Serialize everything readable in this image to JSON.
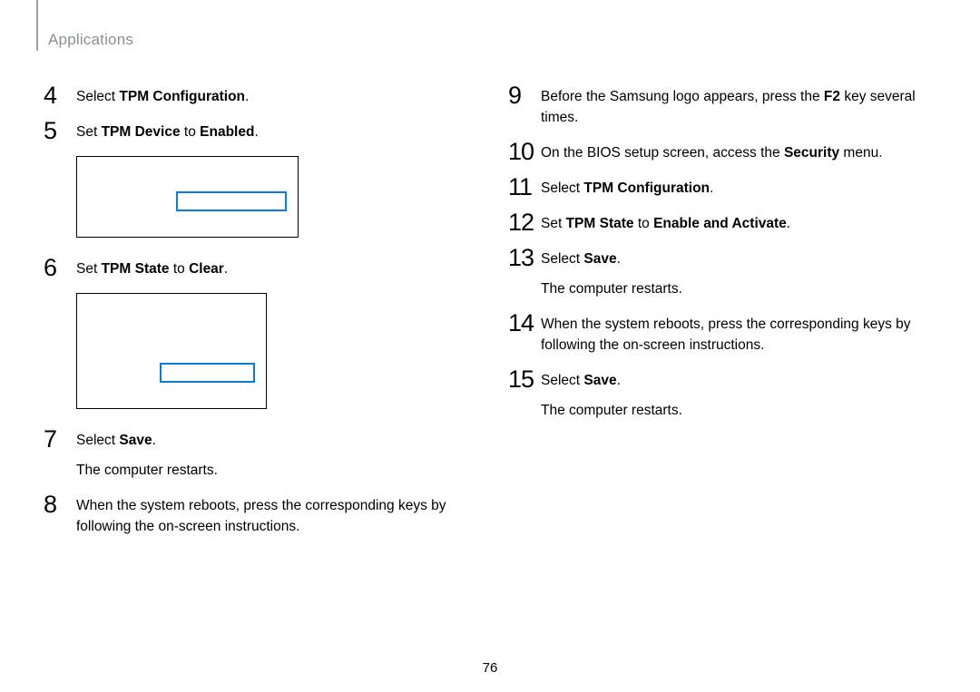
{
  "header": {
    "section": "Applications"
  },
  "page_number": "76",
  "left": {
    "s4": {
      "n": "4",
      "t1": "Select ",
      "b1": "TPM Configuration",
      "t2": "."
    },
    "s5": {
      "n": "5",
      "t1": "Set ",
      "b1": "TPM Device",
      "t2": " to ",
      "b2": "Enabled",
      "t3": "."
    },
    "s6": {
      "n": "6",
      "t1": "Set ",
      "b1": "TPM State",
      "t2": " to ",
      "b2": "Clear",
      "t3": "."
    },
    "s7": {
      "n": "7",
      "t1": "Select ",
      "b1": "Save",
      "t2": ".",
      "sub": "The computer restarts."
    },
    "s8": {
      "n": "8",
      "t1": "When the system reboots, press the corresponding keys by following the on-screen instructions."
    }
  },
  "right": {
    "s9": {
      "n": "9",
      "t1": "Before the Samsung logo appears, press the ",
      "b1": "F2",
      "t2": " key several times."
    },
    "s10": {
      "n": "10",
      "t1": "On the BIOS setup screen, access the ",
      "b1": "Security",
      "t2": " menu."
    },
    "s11": {
      "n": "11",
      "t1": "Select ",
      "b1": "TPM Configuration",
      "t2": "."
    },
    "s12": {
      "n": "12",
      "t1": "Set ",
      "b1": "TPM State",
      "t2": " to ",
      "b2": "Enable and Activate",
      "t3": "."
    },
    "s13": {
      "n": "13",
      "t1": "Select ",
      "b1": "Save",
      "t2": ".",
      "sub": "The computer restarts."
    },
    "s14": {
      "n": "14",
      "t1": "When the system reboots, press the corresponding keys by following the on-screen instructions."
    },
    "s15": {
      "n": "15",
      "t1": "Select ",
      "b1": "Save",
      "t2": ".",
      "sub": "The computer restarts."
    }
  }
}
